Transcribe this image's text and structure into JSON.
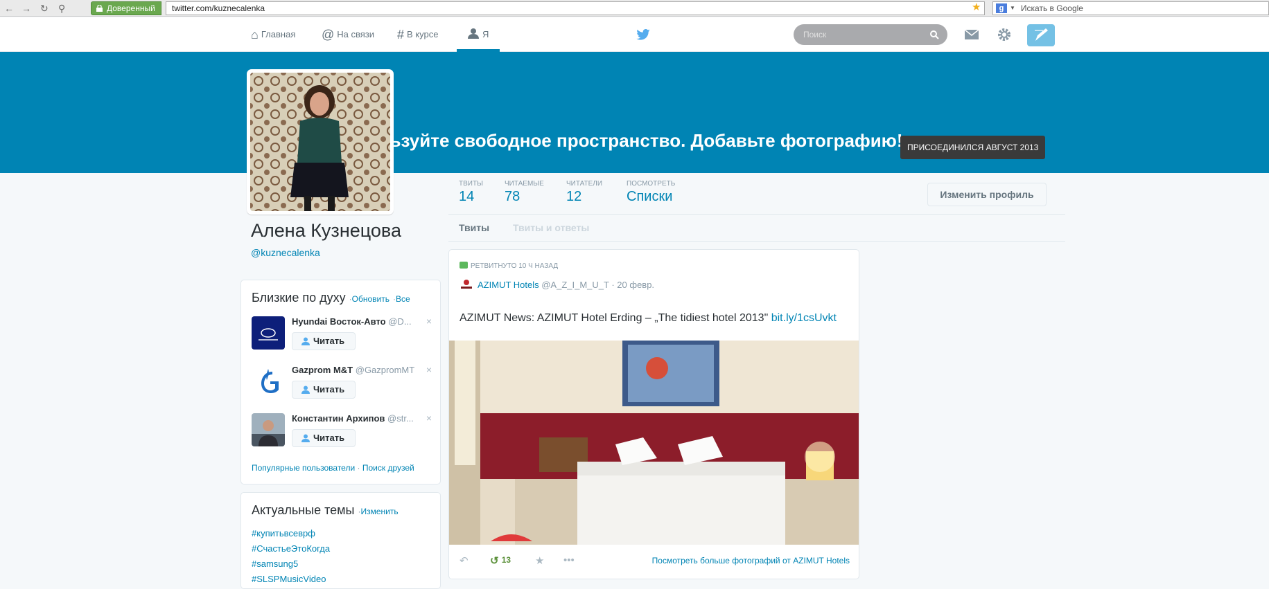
{
  "browser": {
    "secure_label": "Доверенный",
    "url": "twitter.com/kuznecalenka",
    "search_placeholder": "Искать в Google",
    "search_engine_letter": "g"
  },
  "topnav": {
    "items": [
      {
        "label": "Главная",
        "icon": "home-icon"
      },
      {
        "label": "На связи",
        "icon": "at-icon"
      },
      {
        "label": "В курсе",
        "icon": "hash-icon"
      },
      {
        "label": "Я",
        "icon": "person-icon"
      }
    ],
    "search_placeholder": "Поиск",
    "accent": "#0084b4"
  },
  "banner": {
    "message": "льзуйте свободное пространство. Добавьте фотографию!",
    "joined": "ПРИСОЕДИНИЛСЯ АВГУСТ 2013"
  },
  "profile": {
    "name": "Алена Кузнецова",
    "handle": "@kuznecalenka",
    "edit_button": "Изменить профиль"
  },
  "stats": [
    {
      "label": "ТВИТЫ",
      "value": "14"
    },
    {
      "label": "ЧИТАЕМЫЕ",
      "value": "78"
    },
    {
      "label": "ЧИТАТЕЛИ",
      "value": "12"
    },
    {
      "label": "ПОСМОТРЕТЬ",
      "value": "Списки"
    }
  ],
  "tabs": [
    {
      "label": "Твиты",
      "active": true
    },
    {
      "label": "Твиты и ответы",
      "active": false
    }
  ],
  "who_to_follow": {
    "title": "Близкие по духу",
    "refresh": "Обновить",
    "separator": "·",
    "all": "Все",
    "follow_label": "Читать",
    "close_glyph": "×",
    "users": [
      {
        "name": "Hyundai Восток-Авто",
        "handle": "@D..."
      },
      {
        "name": "Gazprom M&T",
        "handle": "@GazpromMT"
      },
      {
        "name": "Константин Архипов",
        "handle": "@str..."
      }
    ],
    "popular": "Популярные пользователи",
    "find_friends": "Поиск друзей"
  },
  "trends": {
    "title": "Актуальные темы",
    "change": "Изменить",
    "items": [
      "#купитьвсеврф",
      "#СчастьеЭтоКогда",
      "#samsung5",
      "#SLSPMusicVideo"
    ]
  },
  "tweet": {
    "retweet_context": "РЕТВИТНУТО 10 Ч НАЗАД",
    "author": "AZIMUT Hotels",
    "author_handle": "@A_Z_I_M_U_T",
    "date": "· 20 февр.",
    "text": "AZIMUT News: AZIMUT Hotel Erding – „The tidiest hotel 2013\"",
    "link": "bit.ly/1csUvkt",
    "retweet_count": "13",
    "more_photos": "Посмотреть больше фотографий от AZIMUT Hotels"
  }
}
